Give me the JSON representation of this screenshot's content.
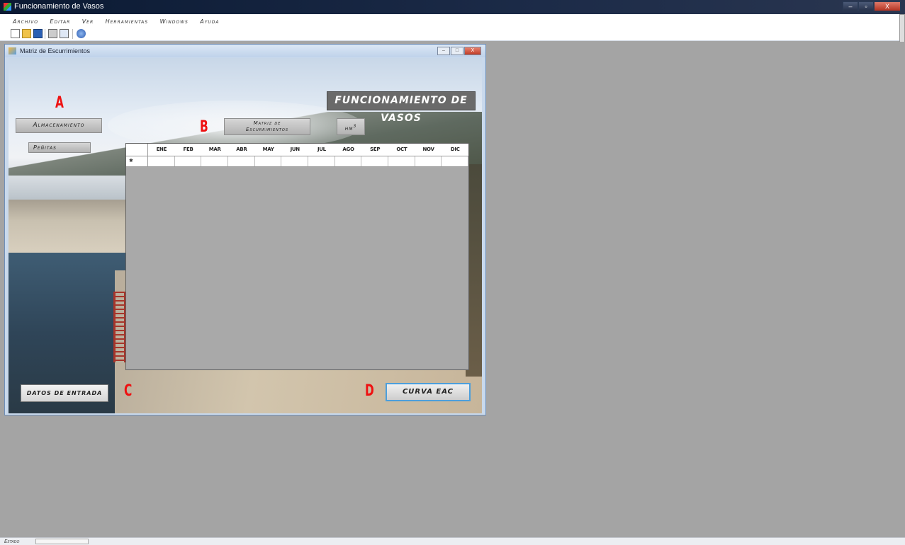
{
  "app": {
    "title": "Funcionamiento de Vasos",
    "window_controls": [
      "–",
      "▫",
      "X"
    ]
  },
  "menu": [
    "Archivo",
    "Editar",
    "Ver",
    "Herramientas",
    "Windows",
    "Ayuda"
  ],
  "toolbar": [
    "new-icon",
    "open-icon",
    "save-icon",
    "print-icon",
    "print-preview-icon",
    "help-icon"
  ],
  "child_window": {
    "title": "Matriz de Escurrimientos",
    "controls": [
      "–",
      "□",
      "X"
    ]
  },
  "form": {
    "banner": "FUNCIONAMIENTO DE VASOS",
    "almacenamiento_label": "Almacenamiento",
    "penitas_label": "Peñitas",
    "matriz_label_1": "Matriz de",
    "matriz_label_2": "Escurrimientos",
    "units_label": "hm",
    "units_sup": "3",
    "datos_label": "DATOS DE ENTRADA",
    "curva_label": "CURVA EAC",
    "markers": [
      "A",
      "B",
      "C",
      "D"
    ]
  },
  "grid": {
    "row_marker": "✱",
    "columns": [
      "ENE",
      "FEB",
      "MAR",
      "ABR",
      "MAY",
      "JUN",
      "JUL",
      "AGO",
      "SEP",
      "OCT",
      "NOV",
      "DIC"
    ]
  },
  "status": {
    "label": "Estado"
  },
  "colors": {
    "title_bar": "#0b1a33",
    "mdi_background": "#a4a4a4",
    "marker": "#ee1111",
    "accent_border": "#4c9fdc"
  }
}
